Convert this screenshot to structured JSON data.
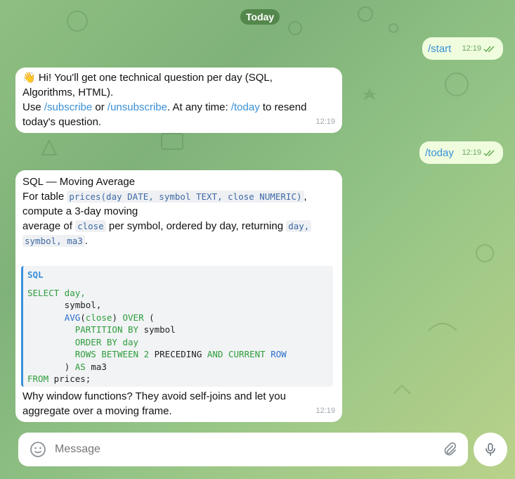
{
  "date_separator": "Today",
  "messages": {
    "start": {
      "text": "/start",
      "time": "12:19"
    },
    "welcome": {
      "line1": "👋 Hi! You'll get one technical question per day (SQL,",
      "line2": "Algorithms, HTML).",
      "line3_pre": "Use ",
      "subscribe": "/subscribe",
      "line3_or": " or ",
      "unsubscribe": "/unsubscribe",
      "line3_mid": ". At any time: ",
      "today": "/today",
      "line3_post": " to resend",
      "line4": "today's question.",
      "time": "12:19"
    },
    "today": {
      "text": "/today",
      "time": "12:19"
    },
    "question": {
      "title": "SQL — Moving Average",
      "p1_pre": "For table ",
      "p1_code": "prices(day DATE, symbol TEXT, close NUMERIC)",
      "p1_post": ",",
      "p2": "compute a 3-day moving",
      "p3_pre": "average of ",
      "p3_code": "close",
      "p3_post": " per symbol, ordered by day, returning ",
      "p3_code2a": "day,",
      "p3_code2b": "symbol, ma3",
      "p3_end": ".",
      "code_lang": "SQL",
      "code": {
        "l1_kw": "SELECT",
        "l1_rest": " day,",
        "l2": "       symbol,",
        "l3_ind": "       ",
        "l3_fn": "AVG",
        "l3_a": "(",
        "l3_kw": "close",
        "l3_b": ") ",
        "l3_kw2": "OVER",
        "l3_c": " (",
        "l4_ind": "         ",
        "l4_kw": "PARTITION BY",
        "l4_rest": " symbol",
        "l5_ind": "         ",
        "l5_kw": "ORDER BY",
        "l5_rest": " day",
        "l6_ind": "         ",
        "l6_kw": "ROWS BETWEEN",
        "l6_num": " 2 ",
        "l6_kw2": "PRECEDING",
        "l6_sp": " ",
        "l6_kw3": "AND",
        "l6_sp2": " ",
        "l6_kw4": "CURRENT",
        "l6_sp3": " ",
        "l6_kw5": "ROW",
        "l7_ind": "       ",
        "l7_a": ") ",
        "l7_kw": "AS",
        "l7_rest": " ma3",
        "l8_kw": "FROM",
        "l8_rest": " prices;"
      },
      "after1": "Why window functions? They avoid self-joins and let you",
      "after2": "aggregate over a moving frame.",
      "time": "12:19"
    }
  },
  "composer": {
    "placeholder": "Message"
  },
  "colors": {
    "accent": "#3a90d6",
    "outgoing": "#effdde",
    "incoming": "#ffffff"
  }
}
